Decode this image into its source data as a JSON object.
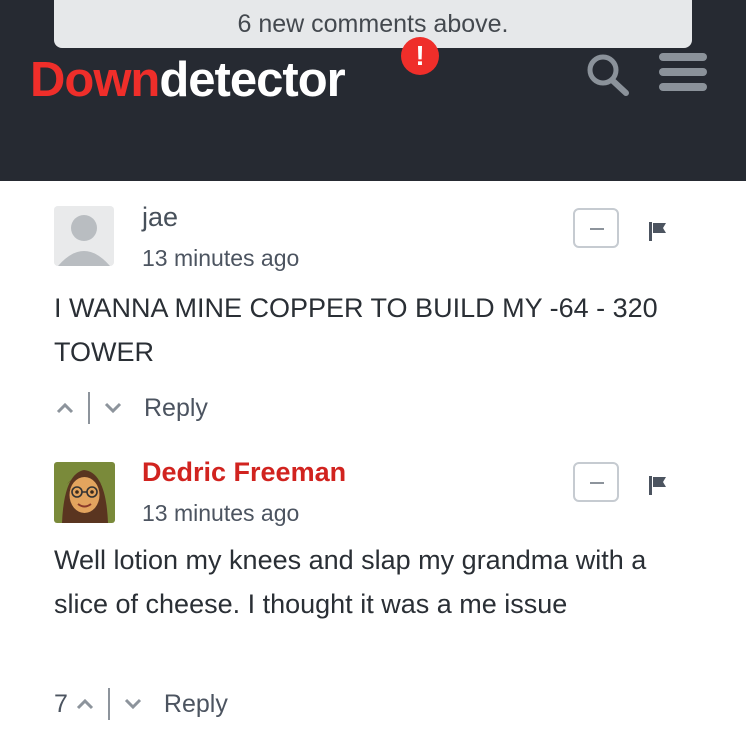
{
  "header": {
    "notice": "6 new comments above.",
    "logo": {
      "part1": "Down",
      "part2": "detector",
      "badge": "!"
    },
    "icons": {
      "search": "search-icon",
      "menu": "menu-icon"
    },
    "colors": {
      "brand_red": "#ef2e2a",
      "header_bg": "#262a32"
    }
  },
  "comments": [
    {
      "author": "jae",
      "time": "13 minutes ago",
      "text": "I WANNA MINE COPPER TO BUILD MY -64 - 320 TOWER",
      "votes": "",
      "reply_label": "Reply",
      "avatar": "generic-user-avatar"
    },
    {
      "author": "Dedric Freeman",
      "time": "13 minutes ago",
      "text": "Well lotion my knees and slap my grandma with a slice of cheese. I thought it was a me issue",
      "votes": "7",
      "reply_label": "Reply",
      "avatar": "cartoon-avatar",
      "author_color": "#d1231f"
    }
  ]
}
